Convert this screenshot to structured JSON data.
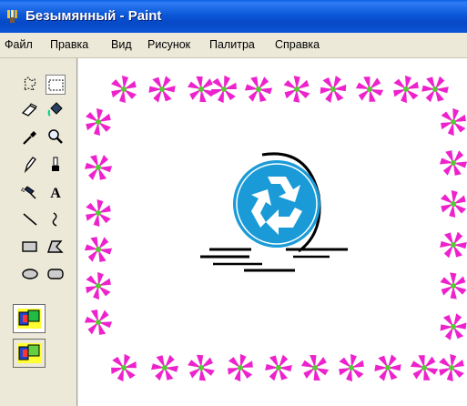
{
  "window": {
    "title": "Безымянный - Paint"
  },
  "menu": {
    "items": [
      {
        "label": "Файл"
      },
      {
        "label": "Правка"
      },
      {
        "label": "Вид"
      },
      {
        "label": "Рисунок"
      },
      {
        "label": "Палитра"
      },
      {
        "label": "Справка"
      }
    ]
  },
  "tools": {
    "text_tool_glyph": "A",
    "selected": "rect-select"
  },
  "colors": {
    "title_bar": "#0b58d8",
    "border_petals": "#ee22cc",
    "border_centers": "#55cc33",
    "recycle_blue": "#1a9bd7"
  }
}
